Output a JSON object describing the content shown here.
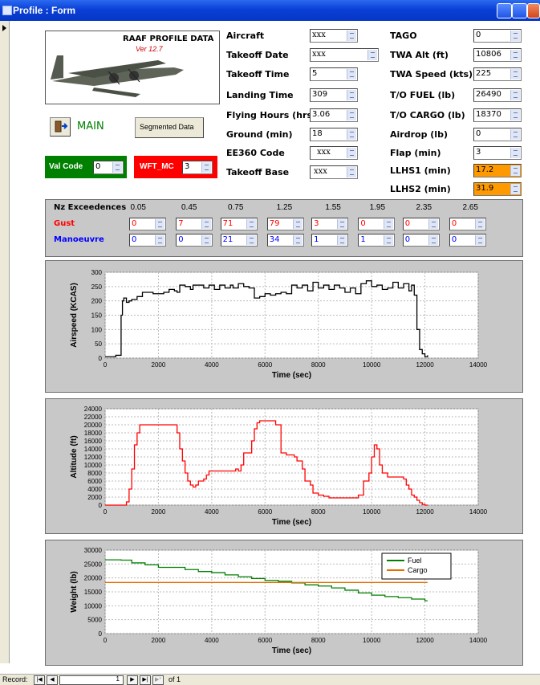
{
  "window": {
    "title": "Profile : Form"
  },
  "header": {
    "title": "RAAF PROFILE DATA",
    "version": "Ver 12.7",
    "main_label": "MAIN",
    "segmented_label": "Segmented Data"
  },
  "codes": {
    "val_label": "Val Code",
    "val_value": "0",
    "wft_label": "WFT_MC",
    "wft_value": "3",
    "val_color": "#008000",
    "wft_color": "#ff0000"
  },
  "fields_mid": [
    {
      "label": "Aircraft",
      "value": "xxx"
    },
    {
      "label": "Takeoff Date",
      "value": "xxx"
    },
    {
      "label": "Takeoff Time",
      "value": "5"
    },
    {
      "label": "Landing Time",
      "value": "309"
    },
    {
      "label": "Flying Hours (hrs)",
      "value": "3.06"
    },
    {
      "label": "Ground (min)",
      "value": "18"
    },
    {
      "label": "EE360 Code",
      "value": "xxx"
    },
    {
      "label": "Takeoff Base",
      "value": "xxx"
    }
  ],
  "fields_right": [
    {
      "label": "TAGO",
      "value": "0"
    },
    {
      "label": "TWA Alt (ft)",
      "value": "10806"
    },
    {
      "label": "TWA Speed (kts)",
      "value": "225"
    },
    {
      "label": "T/O FUEL (lb)",
      "value": "26490"
    },
    {
      "label": "T/O CARGO (lb)",
      "value": "18370"
    },
    {
      "label": "Airdrop (lb)",
      "value": "0"
    },
    {
      "label": "Flap (min)",
      "value": "3"
    },
    {
      "label": "LLHS1 (min)",
      "value": "17.2"
    },
    {
      "label": "LLHS2 (min)",
      "value": "31.9"
    }
  ],
  "highlight_color": "#ff9900",
  "nz": {
    "title": "Nz Exceedences",
    "levels": [
      "0.05",
      "0.45",
      "0.75",
      "1.25",
      "1.55",
      "1.95",
      "2.35",
      "2.65"
    ],
    "gust_label": "Gust",
    "gust_values": [
      "0",
      "7",
      "71",
      "79",
      "3",
      "0",
      "0",
      "0"
    ],
    "gust_color": "#ff0000",
    "man_label": "Manoeuvre",
    "man_values": [
      "0",
      "0",
      "21",
      "34",
      "1",
      "1",
      "0",
      "0"
    ],
    "man_color": "#0000ff"
  },
  "chart_data": [
    {
      "type": "line",
      "title": "",
      "xlabel": "Time (sec)",
      "ylabel": "Airspeed (KCAS)",
      "xlim": [
        0,
        14000
      ],
      "ylim": [
        0,
        300
      ],
      "xticks": [
        0,
        2000,
        4000,
        6000,
        8000,
        10000,
        12000,
        14000
      ],
      "yticks": [
        0,
        50,
        100,
        150,
        200,
        250,
        300
      ],
      "grid": true,
      "series": [
        {
          "color": "#000000",
          "x": [
            0,
            400,
            550,
            600,
            650,
            700,
            800,
            900,
            1000,
            1200,
            1400,
            1600,
            1800,
            2000,
            2200,
            2400,
            2600,
            2700,
            2800,
            3000,
            3200,
            3300,
            3500,
            3700,
            3900,
            4100,
            4300,
            4500,
            4700,
            4800,
            5000,
            5200,
            5400,
            5600,
            5800,
            6000,
            6200,
            6400,
            6600,
            6800,
            7000,
            7200,
            7400,
            7600,
            7800,
            8000,
            8200,
            8400,
            8600,
            8800,
            9000,
            9200,
            9400,
            9600,
            9800,
            10000,
            10200,
            10400,
            10600,
            10800,
            11000,
            11200,
            11400,
            11500,
            11600,
            11700,
            11800,
            11900,
            12000,
            12100
          ],
          "y": [
            5,
            10,
            10,
            150,
            200,
            210,
            195,
            200,
            205,
            215,
            230,
            230,
            225,
            225,
            230,
            240,
            235,
            230,
            255,
            250,
            240,
            255,
            255,
            245,
            255,
            240,
            255,
            245,
            255,
            245,
            260,
            250,
            245,
            210,
            215,
            225,
            220,
            225,
            230,
            225,
            255,
            245,
            255,
            235,
            265,
            245,
            255,
            240,
            255,
            245,
            230,
            245,
            225,
            260,
            270,
            250,
            255,
            240,
            245,
            265,
            245,
            260,
            235,
            255,
            220,
            100,
            30,
            15,
            5,
            10
          ]
        }
      ]
    },
    {
      "type": "line",
      "title": "",
      "xlabel": "Time (sec)",
      "ylabel": "Altitude (ft)",
      "xlim": [
        0,
        14000
      ],
      "ylim": [
        0,
        24000
      ],
      "xticks": [
        0,
        2000,
        4000,
        6000,
        8000,
        10000,
        12000,
        14000
      ],
      "yticks": [
        0,
        2000,
        4000,
        6000,
        8000,
        10000,
        12000,
        14000,
        16000,
        18000,
        20000,
        22000,
        24000
      ],
      "grid": true,
      "series": [
        {
          "color": "#ff0000",
          "x": [
            0,
            700,
            800,
            900,
            1000,
            1100,
            1200,
            1300,
            2600,
            2700,
            2800,
            2900,
            3000,
            3100,
            3200,
            3300,
            3400,
            3500,
            3700,
            3800,
            3900,
            4000,
            4800,
            4900,
            5000,
            5100,
            5200,
            5400,
            5500,
            5600,
            5700,
            5800,
            6300,
            6400,
            6600,
            6800,
            7000,
            7100,
            7200,
            7400,
            7500,
            7700,
            7800,
            8000,
            8200,
            8400,
            8700,
            9300,
            9500,
            9700,
            9900,
            10000,
            10100,
            10200,
            10300,
            10400,
            10600,
            10800,
            11000,
            11200,
            11300,
            11400,
            11500,
            11600,
            11700,
            11800,
            11900,
            12000,
            12100
          ],
          "y": [
            0,
            0,
            800,
            4000,
            9000,
            15000,
            18000,
            20000,
            20000,
            18000,
            14000,
            11000,
            8000,
            6000,
            5000,
            4500,
            5000,
            6000,
            6500,
            7500,
            8500,
            8500,
            8500,
            9000,
            8500,
            10000,
            13000,
            13000,
            16000,
            19000,
            20500,
            21000,
            21000,
            20000,
            13000,
            12500,
            12500,
            12000,
            11000,
            9000,
            6000,
            5000,
            3000,
            2500,
            2200,
            1800,
            1800,
            1800,
            2500,
            6000,
            8000,
            12000,
            15000,
            14000,
            10000,
            8000,
            7000,
            7000,
            7000,
            6500,
            5000,
            4000,
            2500,
            2000,
            1200,
            600,
            200,
            0,
            0
          ]
        }
      ]
    },
    {
      "type": "line",
      "title": "",
      "xlabel": "Time (sec)",
      "ylabel": "Weight (lb)",
      "xlim": [
        0,
        14000
      ],
      "ylim": [
        0,
        30000
      ],
      "xticks": [
        0,
        2000,
        4000,
        6000,
        8000,
        10000,
        12000,
        14000
      ],
      "yticks": [
        0,
        5000,
        10000,
        15000,
        20000,
        25000,
        30000
      ],
      "grid": true,
      "legend": "top-right",
      "series": [
        {
          "name": "Fuel",
          "color": "#008000",
          "x": [
            0,
            600,
            1000,
            1500,
            2000,
            2500,
            3000,
            3500,
            4000,
            4500,
            5000,
            5500,
            6000,
            6500,
            7000,
            7500,
            8000,
            8500,
            9000,
            9500,
            10000,
            10500,
            11000,
            11500,
            12000,
            12100
          ],
          "y": [
            26500,
            26400,
            25400,
            24700,
            23800,
            23800,
            23000,
            22300,
            21900,
            21100,
            20400,
            19800,
            19100,
            18800,
            18200,
            17500,
            17100,
            16400,
            15600,
            14600,
            13800,
            13300,
            12900,
            12400,
            11800,
            11800
          ]
        },
        {
          "name": "Cargo",
          "color": "#e07000",
          "x": [
            0,
            12100
          ],
          "y": [
            18370,
            18370
          ]
        }
      ]
    }
  ],
  "statusbar": {
    "record_label": "Record:",
    "record_value": "1",
    "of_label": "of 1"
  }
}
